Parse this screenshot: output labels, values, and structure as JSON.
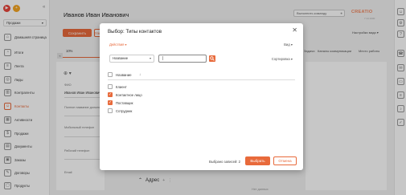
{
  "header": {
    "title": "Иванов Иван Иванович",
    "search_placeholder": "Выполнить команду",
    "brand": "CREATIO",
    "version": "7.14.1000"
  },
  "sidebar": {
    "workspace": "Продажи",
    "items": [
      {
        "label": "Домашняя страница",
        "icon": "home-icon",
        "active": false
      },
      {
        "label": "Итоги",
        "icon": "chart-icon",
        "active": false
      },
      {
        "label": "Лента",
        "icon": "feed-icon",
        "active": false
      },
      {
        "label": "Лиды",
        "icon": "lead-icon",
        "active": false
      },
      {
        "label": "Контрагенты",
        "icon": "building-icon",
        "active": false
      },
      {
        "label": "Контакты",
        "icon": "contact-icon",
        "active": true
      },
      {
        "label": "Активности",
        "icon": "calendar-icon",
        "active": false
      },
      {
        "label": "Продажи",
        "icon": "sale-icon",
        "active": false
      },
      {
        "label": "Документы",
        "icon": "document-icon",
        "active": false
      },
      {
        "label": "Заказы",
        "icon": "order-icon",
        "active": false
      },
      {
        "label": "Договоры",
        "icon": "contract-icon",
        "active": false
      },
      {
        "label": "Продукты",
        "icon": "product-icon",
        "active": false
      }
    ]
  },
  "toolbar": {
    "save_label": "Сохранить",
    "cancel_label": "Отмена",
    "view_settings": "Настройки вида"
  },
  "page": {
    "progress_tab": "10%",
    "profile": {
      "fio_label": "ФИО",
      "fio_value": "Иванов Иван Иванович",
      "position_label": "Полное название должности",
      "mobile_label": "Мобильный телефон",
      "work_phone_label": "Рабочий телефон",
      "email_label": "Email"
    },
    "bg_tabs": [
      "Задачи",
      "Каналы коммуникации",
      "Место работы"
    ],
    "address_label": "Адрес",
    "no_data": "Нет данных"
  },
  "modal": {
    "title": "Выбор: Типы контактов",
    "actions_label": "Действия",
    "view_label": "Вид",
    "filter_column": "Название",
    "filter_value": "|",
    "sort_label": "Сортировка",
    "column_header": "Название",
    "rows": [
      {
        "label": "Клиент",
        "checked": false
      },
      {
        "label": "Контактное лицо",
        "checked": true
      },
      {
        "label": "Поставщик",
        "checked": true
      },
      {
        "label": "Сотрудник",
        "checked": false
      }
    ],
    "selected_label": "Выбрано записей: 2",
    "select_button": "Выбрать",
    "cancel_button": "Отмена"
  },
  "colors": {
    "accent": "#e86a3b",
    "brand": "#f08860",
    "overlay": "rgba(0,0,0,0.22)"
  }
}
